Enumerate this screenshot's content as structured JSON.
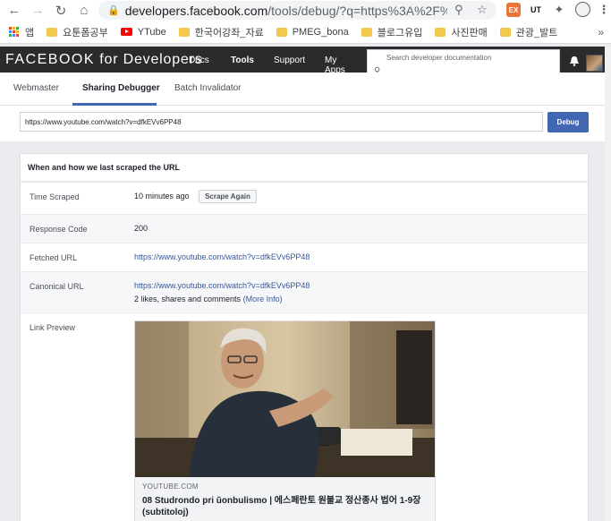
{
  "browser": {
    "url_host": "developers.facebook.com",
    "url_path": "/tools/debug/?q=https%3A%2F%2Fwww.y...",
    "bookmarks": [
      {
        "label": "앱",
        "kind": "apps"
      },
      {
        "label": "요툰폼공부",
        "kind": "folder"
      },
      {
        "label": "YTube",
        "kind": "youtube"
      },
      {
        "label": "한국어강좌_자료",
        "kind": "folder"
      },
      {
        "label": "PMEG_bona",
        "kind": "folder"
      },
      {
        "label": "블로그유입",
        "kind": "folder"
      },
      {
        "label": "사진판매",
        "kind": "folder"
      },
      {
        "label": "관광_발트",
        "kind": "folder"
      }
    ],
    "more_bookmarks": "»"
  },
  "fb_header": {
    "logo_brand": "FACEBOOK",
    "logo_suffix": "for Developers",
    "nav": [
      "Docs",
      "Tools",
      "Support",
      "My Apps"
    ],
    "active_nav": "Tools",
    "search_placeholder": "Search developer documentation"
  },
  "tabs": [
    "Webmaster",
    "Sharing Debugger",
    "Batch Invalidator"
  ],
  "active_tab": "Sharing Debugger",
  "debug_input": {
    "value": "https://www.youtube.com/watch?v=dfkEVv6PP48",
    "button_label": "Debug"
  },
  "results": {
    "heading": "When and how we last scraped the URL",
    "time_scraped": {
      "label": "Time Scraped",
      "value": "10 minutes ago",
      "button": "Scrape Again"
    },
    "response_code": {
      "label": "Response Code",
      "value": "200"
    },
    "fetched_url": {
      "label": "Fetched URL",
      "value": "https://www.youtube.com/watch?v=dfkEVv6PP48"
    },
    "canonical_url": {
      "label": "Canonical URL",
      "value": "https://www.youtube.com/watch?v=dfkEVv6PP48",
      "stats": "2 likes, shares and comments",
      "more_info": "(More Info)"
    },
    "link_preview": {
      "label": "Link Preview",
      "domain": "YOUTUBE.COM",
      "title": "08 Studrondo pri ŭonbulismo | 에스페란토 원불교 정산종사 법어 1-9장 (subtitoloj)"
    }
  },
  "colors": {
    "fb_blue": "#4267b2",
    "link_blue": "#365899",
    "header_dark": "#2b2b2b",
    "page_bg": "#e9ebee"
  }
}
